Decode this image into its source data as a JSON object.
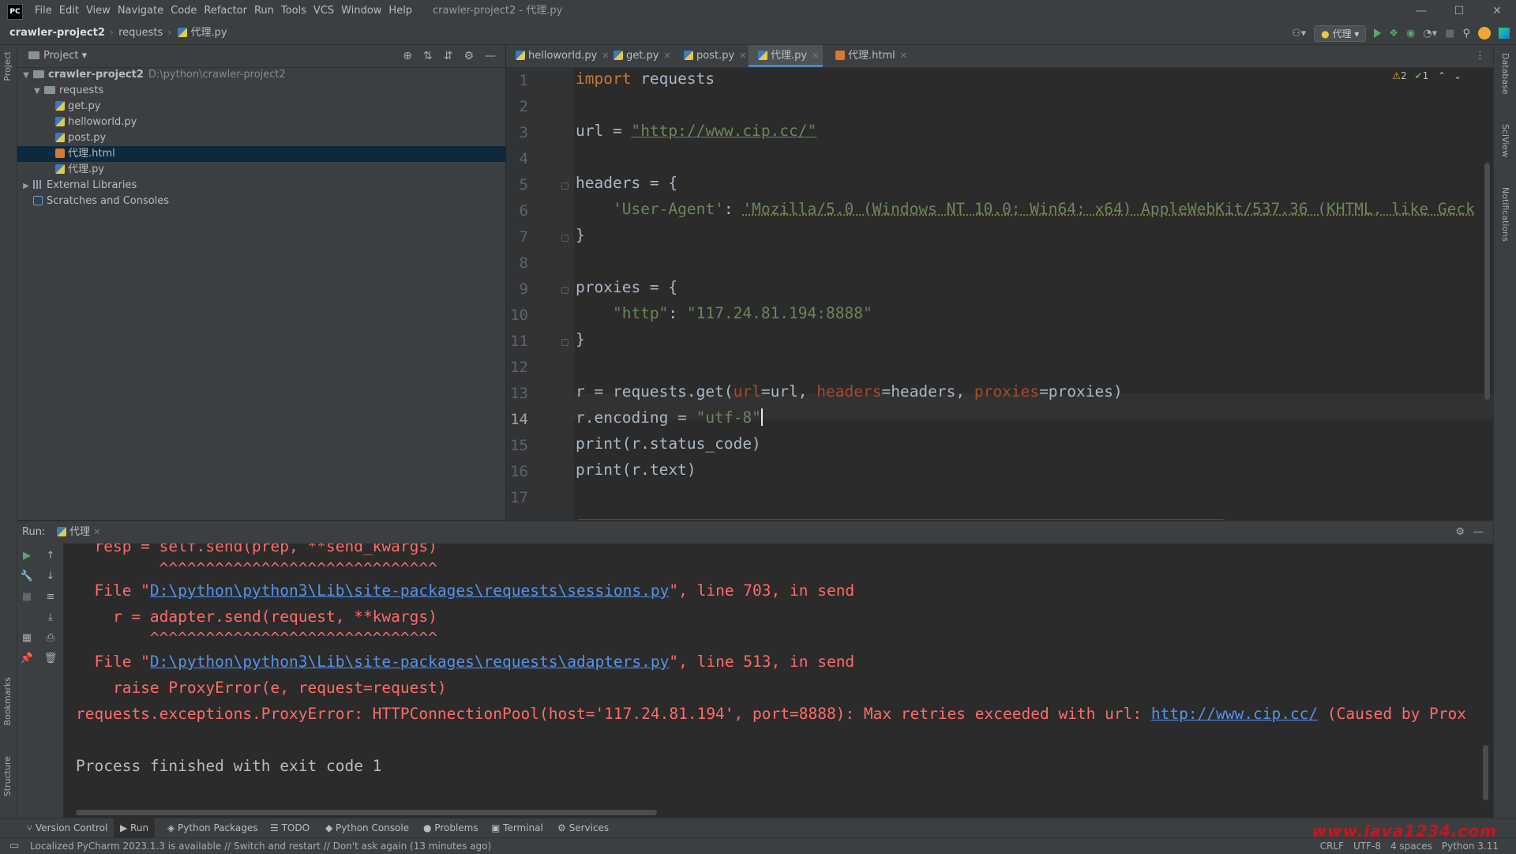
{
  "app": {
    "logo": "PC",
    "window_title": "crawler-project2 - 代理.py"
  },
  "menu": [
    "File",
    "Edit",
    "View",
    "Navigate",
    "Code",
    "Refactor",
    "Run",
    "Tools",
    "VCS",
    "Window",
    "Help"
  ],
  "window_controls": {
    "minimize": "—",
    "maximize": "☐",
    "close": "✕"
  },
  "breadcrumb": [
    "crawler-project2",
    "requests",
    "代理.py"
  ],
  "run_config": "代理",
  "project_panel": {
    "title": "Project",
    "root": {
      "name": "crawler-project2",
      "path": "D:\\python\\crawler-project2"
    },
    "folder": "requests",
    "files": [
      "get.py",
      "helloworld.py",
      "post.py",
      "代理.html",
      "代理.py"
    ],
    "selected": "代理.html",
    "external": "External Libraries",
    "scratches": "Scratches and Consoles"
  },
  "editor_tabs": [
    "helloworld.py",
    "get.py",
    "post.py",
    "代理.py",
    "代理.html"
  ],
  "active_tab": "代理.py",
  "inspections": {
    "warnings": "2",
    "ok": "1"
  },
  "line_numbers": [
    "1",
    "2",
    "3",
    "4",
    "5",
    "6",
    "7",
    "8",
    "9",
    "10",
    "11",
    "12",
    "13",
    "14",
    "15",
    "16",
    "17"
  ],
  "current_line": "14",
  "code": {
    "l1_kw": "import",
    "l1_rest": " requests",
    "l3_a": "url = ",
    "l3_url": "\"http://www.cip.cc/\"",
    "l5": "headers = {",
    "l6_key": "'User-Agent'",
    "l6_colon": ": ",
    "l6_val": "'Mozilla/5.0 (Windows NT 10.0; Win64; x64) AppleWebKit/537.36 (KHTML, like Geck",
    "l7": "}",
    "l9": "proxies = {",
    "l10_key": "\"http\"",
    "l10_colon": ": ",
    "l10_val": "\"117.24.81.194:8888\"",
    "l11": "}",
    "l13_a": "r = requests.get(",
    "l13_p1": "url",
    "l13_b": "=url, ",
    "l13_p2": "headers",
    "l13_c": "=headers, ",
    "l13_p3": "proxies",
    "l13_d": "=proxies)",
    "l14_a": "r.encoding = ",
    "l14_str": "\"utf-8\"",
    "l15": "print(r.status_code)",
    "l16": "print(r.text)"
  },
  "run": {
    "label": "Run:",
    "tab": "代理",
    "lines": {
      "o0": "  resp = self.send(prep, **send_kwargs)",
      "o1": "         ^^^^^^^^^^^^^^^^^^^^^^^^^^^^^^",
      "o2_a": "  File \"",
      "o2_link": "D:\\python\\python3\\Lib\\site-packages\\requests\\sessions.py",
      "o2_b": "\", line 703, in send",
      "o3": "    r = adapter.send(request, **kwargs)",
      "o4": "        ^^^^^^^^^^^^^^^^^^^^^^^^^^^^^^^",
      "o5_a": "  File \"",
      "o5_link": "D:\\python\\python3\\Lib\\site-packages\\requests\\adapters.py",
      "o5_b": "\", line 513, in send",
      "o6": "    raise ProxyError(e, request=request)",
      "o7_a": "requests.exceptions.ProxyError: HTTPConnectionPool(host='117.24.81.194', port=8888): Max retries exceeded with url: ",
      "o7_link": "http://www.cip.cc/",
      "o7_b": " (Caused by Prox",
      "o8": "Process finished with exit code 1"
    }
  },
  "tool_tabs": [
    "Version Control",
    "Run",
    "Python Packages",
    "TODO",
    "Python Console",
    "Problems",
    "Terminal",
    "Services"
  ],
  "side_labels": {
    "left_top": "Project",
    "left_b1": "Bookmarks",
    "left_b2": "Structure",
    "right1": "Database",
    "right2": "SciView",
    "right3": "Notifications"
  },
  "status": {
    "message": "Localized PyCharm 2023.1.3 is available // Switch and restart // Don't ask again (13 minutes ago)",
    "line_sep": "CRLF",
    "encoding": "UTF-8",
    "indent": "4 spaces",
    "interpreter": "Python 3.11"
  },
  "watermark": "www.java1234.com",
  "colors": {
    "accent": "#4a88c7",
    "error": "#ff6b68",
    "keyword": "#cc7832",
    "string": "#6a8759",
    "param": "#aa4926"
  }
}
